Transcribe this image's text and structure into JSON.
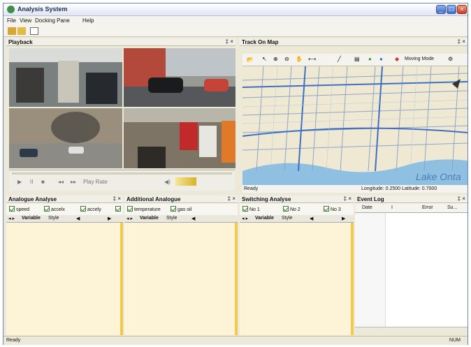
{
  "window": {
    "title": "Analysis System"
  },
  "menu": [
    "File",
    "View",
    "Docking Pane",
    "Help"
  ],
  "playback": {
    "title": "Playback",
    "controls_label": "Play Rate"
  },
  "map": {
    "title": "Track On Map",
    "mode_label": "Moving Mode",
    "status": "Ready",
    "coords": "Longitude: 0.2500  Latitude: 0.7000",
    "lake_label": "Lake Onta"
  },
  "panel_controls": {
    "pin": "‡",
    "close": "×"
  },
  "analogue": {
    "title": "Analogue Analyse",
    "checks": [
      "speed",
      "accelx",
      "accely"
    ]
  },
  "additional": {
    "title": "Additional Analogue",
    "checks": [
      "temperature",
      "gas oil"
    ]
  },
  "switching": {
    "title": "Switching Analyse",
    "checks": [
      "No 1",
      "No 2",
      "No 3"
    ]
  },
  "eventlog": {
    "title": "Event Log",
    "buttons": [
      "Date",
      "I",
      "Error",
      "Su..."
    ]
  },
  "tabs": {
    "variable": "Variable",
    "style": "Style"
  },
  "status": {
    "left": "Ready",
    "right": "NUM"
  }
}
